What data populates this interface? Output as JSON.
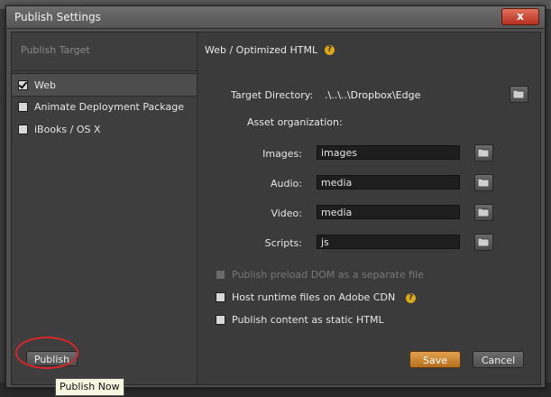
{
  "window": {
    "title": "Publish Settings",
    "close_label": "x"
  },
  "sidebar": {
    "heading": "Publish Target",
    "items": [
      {
        "label": "Web",
        "checked": true
      },
      {
        "label": "Animate Deployment Package",
        "checked": false
      },
      {
        "label": "iBooks / OS X",
        "checked": false
      }
    ],
    "publish_label": "Publish"
  },
  "main": {
    "section_title": "Web / Optimized HTML",
    "help_glyph": "?",
    "target_directory_label": "Target Directory:",
    "target_directory_value": ".\\..\\..\\Dropbox\\Edge",
    "asset_org_label": "Asset organization:",
    "assets": [
      {
        "label": "Images:",
        "value": "images"
      },
      {
        "label": "Audio:",
        "value": "media"
      },
      {
        "label": "Video:",
        "value": "media"
      },
      {
        "label": "Scripts:",
        "value": "js"
      }
    ],
    "options": [
      {
        "label": "Publish preload DOM as a separate file",
        "checked": false,
        "disabled": true
      },
      {
        "label": "Host runtime files on Adobe CDN",
        "checked": false,
        "disabled": false
      },
      {
        "label": "Publish content as static HTML",
        "checked": false,
        "disabled": false
      }
    ],
    "save_label": "Save",
    "cancel_label": "Cancel"
  },
  "tooltip": {
    "text": "Publish Now"
  },
  "colors": {
    "accent_save": "#c98331",
    "highlight_ring": "#d9262a",
    "help_icon": "#d9a818"
  }
}
